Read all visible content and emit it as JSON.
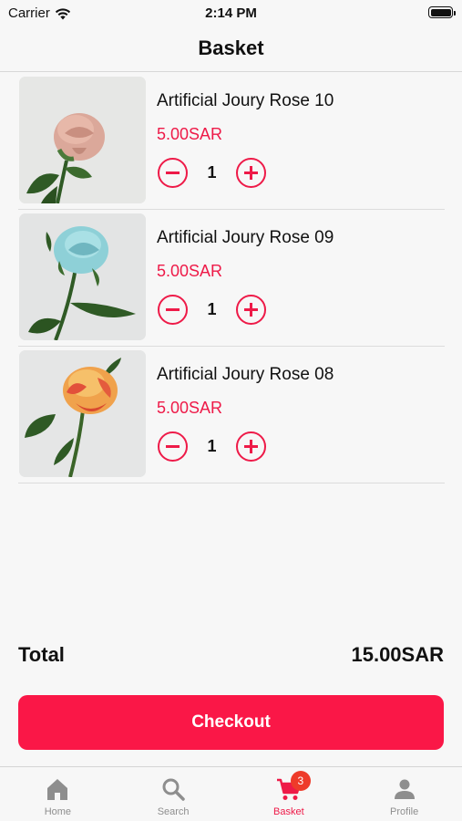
{
  "status_bar": {
    "carrier": "Carrier",
    "time": "2:14 PM"
  },
  "header": {
    "title": "Basket"
  },
  "colors": {
    "accent": "#ee1a48",
    "checkout": "#fa1747",
    "badge": "#ee3b2a"
  },
  "items": [
    {
      "name": "Artificial Joury Rose 10",
      "price": "5.00SAR",
      "quantity": "1",
      "image": "pink-rose"
    },
    {
      "name": "Artificial Joury Rose 09",
      "price": "5.00SAR",
      "quantity": "1",
      "image": "blue-rose"
    },
    {
      "name": "Artificial Joury Rose 08",
      "price": "5.00SAR",
      "quantity": "1",
      "image": "orange-rose"
    }
  ],
  "summary": {
    "total_label": "Total",
    "total_value": "15.00SAR"
  },
  "checkout": {
    "label": "Checkout"
  },
  "tabs": [
    {
      "label": "Home",
      "icon": "home-icon",
      "active": false
    },
    {
      "label": "Search",
      "icon": "search-icon",
      "active": false
    },
    {
      "label": "Basket",
      "icon": "cart-icon",
      "active": true,
      "badge": "3"
    },
    {
      "label": "Profile",
      "icon": "person-icon",
      "active": false
    }
  ]
}
